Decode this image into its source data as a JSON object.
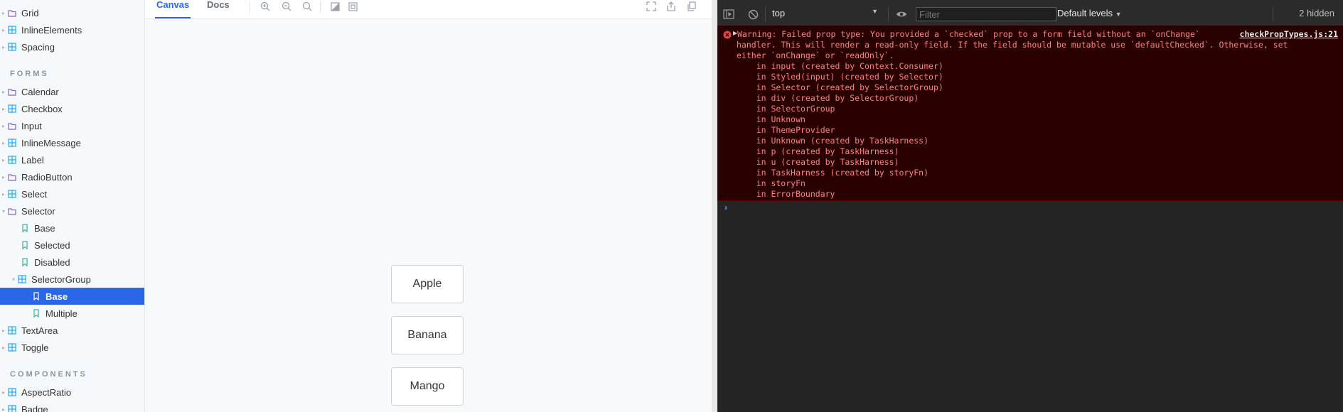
{
  "sidebar": {
    "top_items": [
      {
        "label": "Grid",
        "icon": "folder-icon"
      },
      {
        "label": "InlineElements",
        "icon": "component-icon"
      },
      {
        "label": "Spacing",
        "icon": "component-icon"
      }
    ],
    "forms_heading": "FORMS",
    "forms_items": [
      {
        "label": "Calendar",
        "icon": "folder-icon"
      },
      {
        "label": "Checkbox",
        "icon": "component-icon"
      },
      {
        "label": "Input",
        "icon": "folder-icon"
      },
      {
        "label": "InlineMessage",
        "icon": "component-icon"
      },
      {
        "label": "Label",
        "icon": "component-icon"
      },
      {
        "label": "RadioButton",
        "icon": "folder-icon"
      },
      {
        "label": "Select",
        "icon": "component-icon"
      },
      {
        "label": "Selector",
        "icon": "folder-icon"
      },
      {
        "label": "Base",
        "icon": "bookmark-icon"
      },
      {
        "label": "Selected",
        "icon": "bookmark-icon"
      },
      {
        "label": "Disabled",
        "icon": "bookmark-icon"
      },
      {
        "label": "SelectorGroup",
        "icon": "component-icon"
      },
      {
        "label": "Base",
        "icon": "bookmark-icon"
      },
      {
        "label": "Multiple",
        "icon": "bookmark-icon"
      },
      {
        "label": "TextArea",
        "icon": "component-icon"
      },
      {
        "label": "Toggle",
        "icon": "component-icon"
      }
    ],
    "components_heading": "COMPONENTS",
    "components_items": [
      {
        "label": "AspectRatio",
        "icon": "component-icon"
      },
      {
        "label": "Badge",
        "icon": "component-icon"
      }
    ]
  },
  "canvas": {
    "tabs": {
      "canvas": "Canvas",
      "docs": "Docs"
    },
    "options": [
      "Apple",
      "Banana",
      "Mango"
    ]
  },
  "devtools": {
    "context": "top",
    "filter_placeholder": "Filter",
    "levels": "Default levels",
    "hidden": "2 hidden",
    "error": {
      "source": "checkPropTypes.js:21",
      "lines": [
        "Warning: Failed prop type: You provided a `checked` prop to a form field without an `onChange`",
        "handler. This will render a read-only field. If the field should be mutable use `defaultChecked`. Otherwise, set",
        "either `onChange` or `readOnly`.",
        "    in input (created by Context.Consumer)",
        "    in Styled(input) (created by Selector)",
        "    in Selector (created by SelectorGroup)",
        "    in div (created by SelectorGroup)",
        "    in SelectorGroup",
        "    in Unknown",
        "    in ThemeProvider",
        "    in Unknown (created by TaskHarness)",
        "    in p (created by TaskHarness)",
        "    in u (created by TaskHarness)",
        "    in TaskHarness (created by storyFn)",
        "    in storyFn",
        "    in ErrorBoundary"
      ]
    },
    "prompt_symbol": "›"
  },
  "colors": {
    "accent": "#2b66e8",
    "icon_teal": "#37b1a2",
    "icon_purple": "#8a5fd4",
    "error_bg": "#290000",
    "error_text": "#ff8080"
  }
}
